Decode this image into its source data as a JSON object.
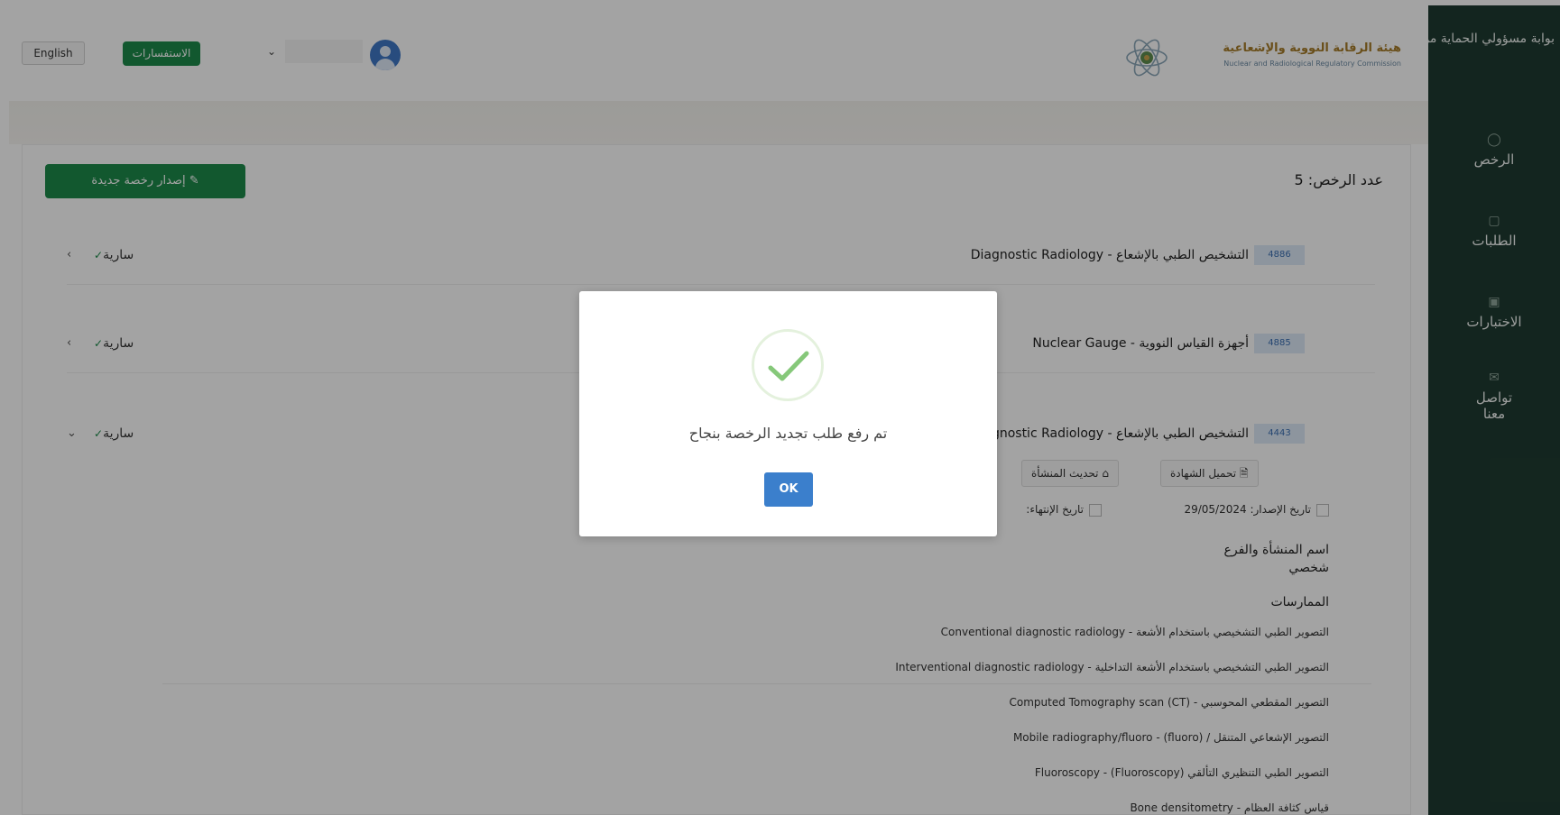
{
  "sidebar": {
    "portal_title": "بوابة مسؤولي الحماية من الإشعاع",
    "items": [
      {
        "label": "الرخص",
        "icon": "license-icon"
      },
      {
        "label": "الطلبات",
        "icon": "requests-icon"
      },
      {
        "label": "الاختبارات",
        "icon": "tests-icon"
      },
      {
        "label": "تواصل معنا",
        "icon": "contact-icon"
      }
    ]
  },
  "header": {
    "language_label": "English",
    "inquiries_label": "الاستفسارات",
    "logo": {
      "name_ar": "هيئة الرقابة النووية والإشعاعية",
      "name_en": "Nuclear and Radiological Regulatory Commission"
    }
  },
  "main": {
    "issue_button": "إصدار رخصة جديدة",
    "license_count": "عدد الرخص: 5",
    "licenses": [
      {
        "code": "4886",
        "name": "التشخيص الطبي بالإشعاع - Diagnostic Radiology",
        "status": "سارية"
      },
      {
        "code": "4885",
        "name": "أجهزة القياس النووية - Nuclear Gauge",
        "status": "سارية"
      },
      {
        "code": "4443",
        "name": "التشخيص الطبي بالإشعاع - Diagnostic Radiology",
        "status": "سارية"
      }
    ],
    "expanded": {
      "download_certificate": "تحميل الشهادة",
      "update_facility": "تحديث المنشأة",
      "issue_date_label": "تاريخ الإصدار:",
      "issue_date": "29/05/2024",
      "expiry_date_label": "تاريخ الإنتهاء:",
      "facility_label": "اسم المنشأة والفرع",
      "facility_value": "شخصي",
      "practices_label": "الممارسات",
      "practices": [
        "التصوير الطبي التشخيصي باستخدام الأشعة - Conventional diagnostic radiology",
        "التصوير الطبي التشخيصي باستخدام الأشعة التداخلية - Interventional diagnostic radiology",
        "التصوير المقطعي المحوسبي - Computed Tomography scan (CT)",
        "التصوير الإشعاعي المتنقل / (fluoro) - Mobile radiography/fluoro",
        "التصوير الطبي التنظيري التألقي (Fluoroscopy) - Fluoroscopy",
        "قياس كثافة العظام - Bone densitometry"
      ]
    }
  },
  "modal": {
    "message": "تم رفع طلب تجديد الرخصة بنجاح",
    "ok_label": "OK"
  },
  "colors": {
    "sidebar": "#1f3b31",
    "primary_green": "#1d8a4a",
    "ok_blue": "#3b7fcc",
    "code_badge": "#dde9f7"
  }
}
